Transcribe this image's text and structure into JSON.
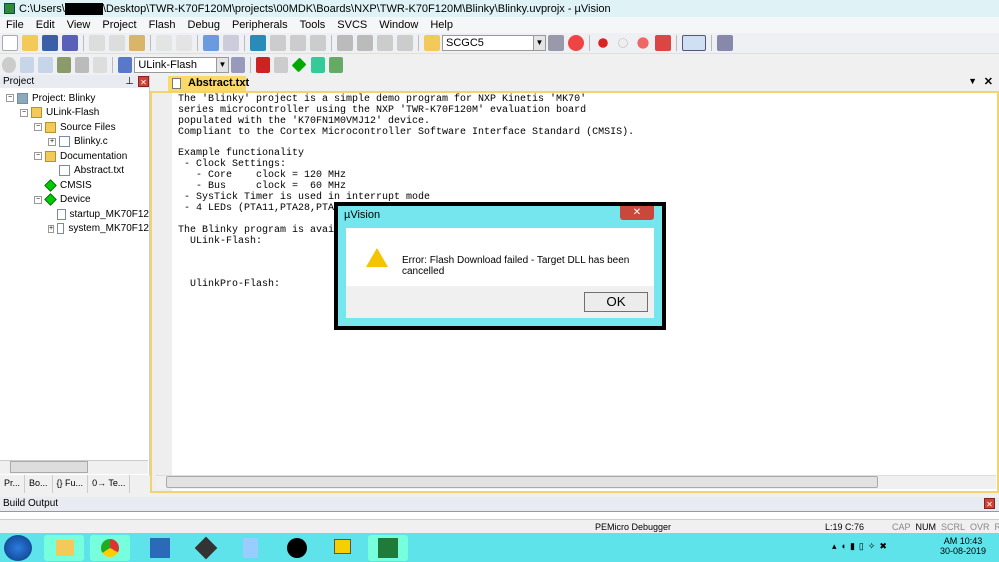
{
  "window": {
    "title_prefix": "C:\\Users\\",
    "title_suffix": "\\Desktop\\TWR-K70F120M\\projects\\00MDK\\Boards\\NXP\\TWR-K70F120M\\Blinky\\Blinky.uvprojx - µVision"
  },
  "menu": [
    "File",
    "Edit",
    "View",
    "Project",
    "Flash",
    "Debug",
    "Peripherals",
    "Tools",
    "SVCS",
    "Window",
    "Help"
  ],
  "toolbar": {
    "find_combo": "SCGC5",
    "target_combo": "ULink-Flash"
  },
  "project": {
    "title": "Project",
    "tree": [
      {
        "label": "Project: Blinky",
        "level": 0,
        "toggle": "−",
        "icon": "project"
      },
      {
        "label": "ULink-Flash",
        "level": 1,
        "toggle": "−",
        "icon": "folder"
      },
      {
        "label": "Source Files",
        "level": 2,
        "toggle": "−",
        "icon": "folder"
      },
      {
        "label": "Blinky.c",
        "level": 3,
        "toggle": "+",
        "icon": "file"
      },
      {
        "label": "Documentation",
        "level": 2,
        "toggle": "−",
        "icon": "folder"
      },
      {
        "label": "Abstract.txt",
        "level": 3,
        "toggle": "",
        "icon": "file"
      },
      {
        "label": "CMSIS",
        "level": 2,
        "toggle": "",
        "icon": "diamond"
      },
      {
        "label": "Device",
        "level": 2,
        "toggle": "−",
        "icon": "diamond"
      },
      {
        "label": "startup_MK70F12",
        "level": 3,
        "toggle": "",
        "icon": "file"
      },
      {
        "label": "system_MK70F12",
        "level": 3,
        "toggle": "+",
        "icon": "file"
      }
    ],
    "tabs": [
      "Pr...",
      "Bo...",
      "{} Fu...",
      "0→ Te..."
    ]
  },
  "editor": {
    "tab": "Abstract.txt",
    "lines": [
      "The 'Blinky' project is a simple demo program for NXP Kinetis 'MK70'",
      "series microcontroller using the NXP 'TWR-K70F120M' evaluation board",
      "populated with the 'K70FN1M0VMJ12' device.",
      "Compliant to the Cortex Microcontroller Software Interface Standard (CMSIS).",
      "",
      "Example functionality",
      " - Clock Settings:",
      "   - Core    clock = 120 MHz",
      "   - Bus     clock =  60 MHz",
      " - SysTick Timer is used in interrupt mode",
      " - 4 LEDs (PTA11,PTA28,PTA29,PT",
      "",
      "The Blinky program is available",
      "  ULink-Flash:",
      "",
      "",
      "",
      "  UlinkPro-Flash:"
    ]
  },
  "dialog": {
    "title": "µVision",
    "message": "Error: Flash Download failed  -  Target DLL has been cancelled",
    "ok": "OK",
    "close": "✕"
  },
  "build": {
    "title": "Build Output"
  },
  "status": {
    "debugger": "PEMicro Debugger",
    "position": "L:19 C:76",
    "indicators": [
      "CAP",
      "NUM",
      "SCRL",
      "OVR",
      "R/W"
    ]
  },
  "taskbar": {
    "time": "AM 10:43",
    "date": "30-08-2019"
  }
}
